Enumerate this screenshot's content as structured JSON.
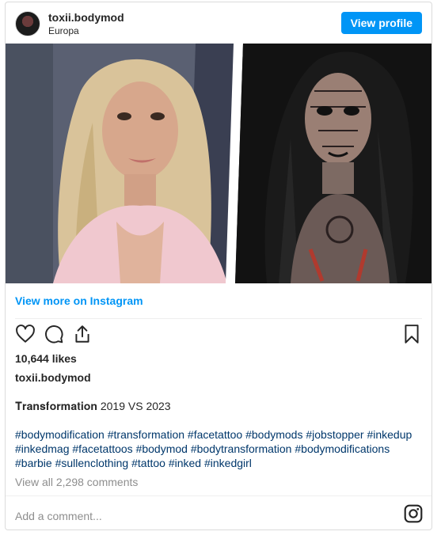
{
  "header": {
    "username": "toxii.bodymod",
    "location": "Europa",
    "view_profile_label": "View profile"
  },
  "media": {
    "left_panel": "photo-before",
    "right_panel": "photo-after"
  },
  "view_more_label": "View more on Instagram",
  "actions": {
    "like_icon": "heart-icon",
    "comment_icon": "comment-icon",
    "share_icon": "share-icon",
    "save_icon": "bookmark-icon"
  },
  "likes_text": "10,644 likes",
  "caption": {
    "username": "toxii.bodymod",
    "title_bold": "𝐓𝐫𝐚𝐧𝐬𝐟𝐨𝐫𝐦𝐚𝐭𝐢𝐨𝐧",
    "title_rest": " 2019 VS 2023",
    "hashtags": [
      "#bodymodification",
      "#transformation",
      "#facetattoo",
      "#bodymods",
      "#jobstopper",
      "#inkedup",
      "#inkedmag",
      "#facetattoos",
      "#bodymod",
      "#bodytransformation",
      "#bodymodifications",
      "#barbie",
      "#sullenclothing",
      "#tattoo",
      "#inked",
      "#inkedgirl"
    ]
  },
  "comments_text": "View all 2,298 comments",
  "add_comment_placeholder": "Add a comment...",
  "colors": {
    "primary_button": "#0095f6",
    "hashtag": "#00376b",
    "muted": "#8e8e8e"
  }
}
